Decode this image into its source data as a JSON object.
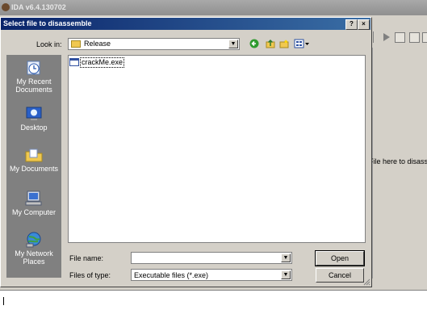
{
  "app": {
    "title": "IDA v6.4.130702"
  },
  "workspace": {
    "drop_hint": "File here to disass"
  },
  "dialog": {
    "title": "Select file to disassemble",
    "help_button": "?",
    "close_button": "×",
    "look_in_label": "Look in:",
    "look_in_value": "Release",
    "places": [
      "My Recent Documents",
      "Desktop",
      "My Documents",
      "My Computer",
      "My Network Places"
    ],
    "files": [
      "crackMe.exe"
    ],
    "file_name_label": "File name:",
    "file_name_value": "",
    "file_type_label": "Files of type:",
    "file_type_value": "Executable files (*.exe)",
    "open_button": "Open",
    "cancel_button": "Cancel"
  },
  "colors": {
    "title_active": "#0a246a",
    "places_bar": "#808080",
    "face": "#d4d0c8"
  }
}
